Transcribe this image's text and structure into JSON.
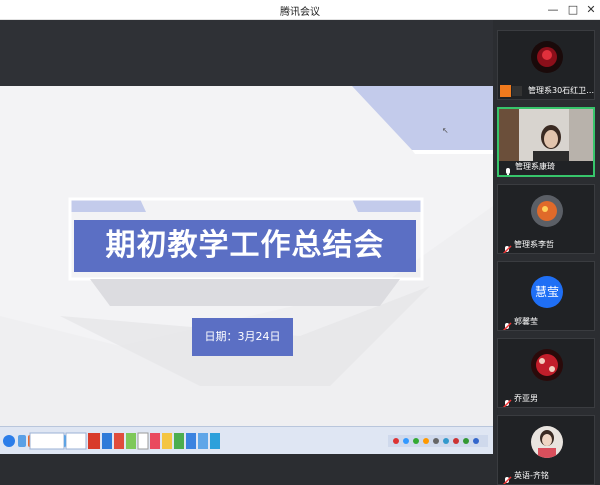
{
  "window": {
    "title": "腾讯会议",
    "minimize_icon": "minimize-icon",
    "maximize_icon": "maximize-icon",
    "close_icon": "close-icon"
  },
  "slide": {
    "title": "期初教学工作总结会",
    "date": "日期：3月24日"
  },
  "taskbar": {
    "items": [
      "start-orb",
      "quick-launch",
      "meeting-app",
      "ppt-window",
      "office",
      "browser",
      "video",
      "explorer",
      "chat",
      "tray"
    ]
  },
  "participants": [
    {
      "name": "管理系30石红卫…",
      "avatar": "red-flower-avatar",
      "mic": "mic-muted-icon",
      "video": false,
      "active": false
    },
    {
      "name": "管理系康琦",
      "avatar": "camera-video",
      "mic": "mic-icon",
      "video": true,
      "active": true
    },
    {
      "name": "管理系李哲",
      "avatar": "orange-fox-avatar",
      "mic": "mic-muted-icon",
      "video": false,
      "active": false
    },
    {
      "name": "郭馨莹",
      "avatar_text": "慧莹",
      "mic": "mic-muted-icon",
      "video": false,
      "active": false
    },
    {
      "name": "乔亚男",
      "avatar": "red-pattern-avatar",
      "mic": "mic-muted-icon",
      "video": false,
      "active": false
    },
    {
      "name": "英语-齐铭",
      "avatar": "person-avatar",
      "mic": "mic-muted-icon",
      "video": false,
      "active": false
    }
  ],
  "colors": {
    "accent": "#5b6fc4",
    "active_border": "#37c56b",
    "avatar_blue": "#1f6ff5"
  }
}
